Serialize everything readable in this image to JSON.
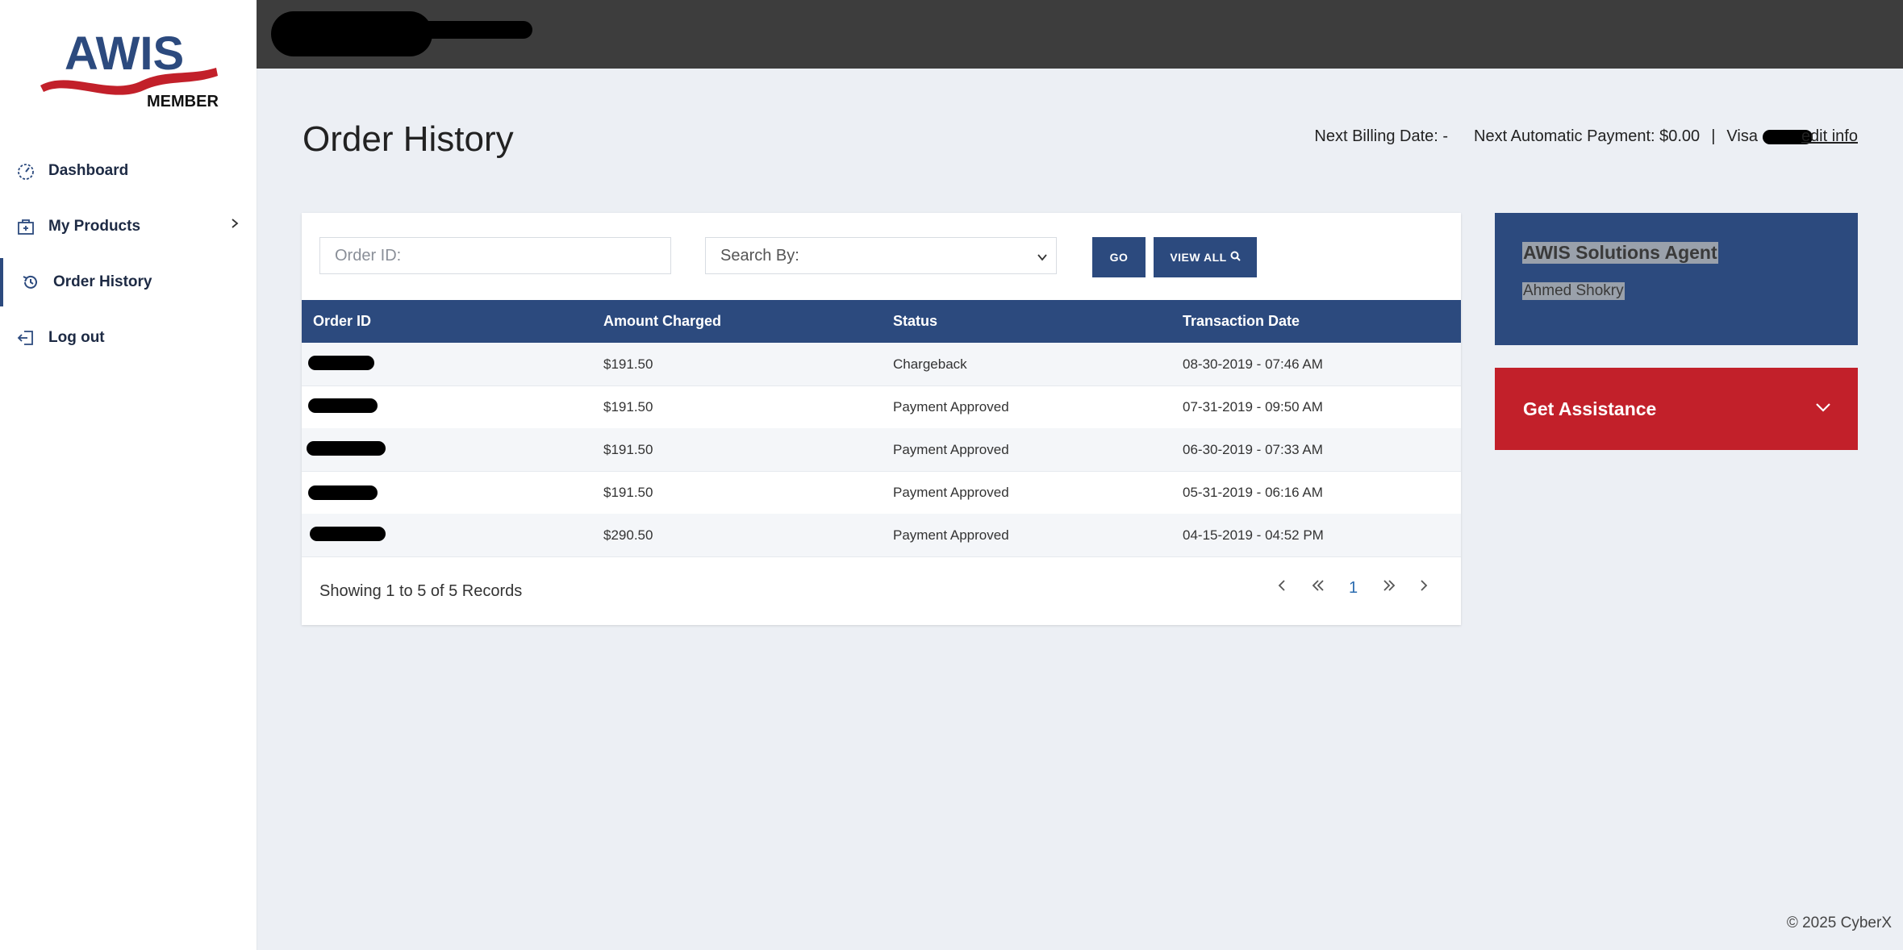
{
  "brand": {
    "logo_text": "AWIS",
    "logo_sub": "MEMBER"
  },
  "sidebar": {
    "items": [
      {
        "label": "Dashboard",
        "icon": "dashboard-gauge-icon"
      },
      {
        "label": "My Products",
        "icon": "product-box-icon"
      },
      {
        "label": "Order History",
        "icon": "history-icon"
      },
      {
        "label": "Log out",
        "icon": "logout-icon"
      }
    ]
  },
  "page": {
    "title": "Order History"
  },
  "billing": {
    "next_billing": "Next Billing Date: -",
    "next_payment": "Next Automatic Payment: $0.00",
    "separator": "|",
    "card_brand": "Visa",
    "edit_link": "edit info"
  },
  "search": {
    "order_id_placeholder": "Order ID:",
    "search_by_label": "Search By:",
    "go_label": "GO",
    "view_all_label": "VIEW ALL"
  },
  "table": {
    "headers": [
      "Order ID",
      "Amount Charged",
      "Status",
      "Transaction Date"
    ],
    "rows": [
      {
        "amount": "$191.50",
        "status": "Chargeback",
        "date": "08-30-2019 - 07:46 AM"
      },
      {
        "amount": "$191.50",
        "status": "Payment Approved",
        "date": "07-31-2019 - 09:50 AM"
      },
      {
        "amount": "$191.50",
        "status": "Payment Approved",
        "date": "06-30-2019 - 07:33 AM"
      },
      {
        "amount": "$191.50",
        "status": "Payment Approved",
        "date": "05-31-2019 - 06:16 AM"
      },
      {
        "amount": "$290.50",
        "status": "Payment Approved",
        "date": "04-15-2019 - 04:52 PM"
      }
    ],
    "records_text": "Showing 1 to 5 of 5 Records",
    "current_page": "1"
  },
  "agent": {
    "title": "AWIS Solutions Agent",
    "name": "Ahmed Shokry"
  },
  "assistance": {
    "label": "Get Assistance"
  },
  "footer": {
    "copyright": "© 2025 CyberX"
  },
  "colors": {
    "primary": "#2c4a7e",
    "danger": "#c2202a",
    "topbar": "#3d3d3d",
    "page_bg": "#eceff4"
  }
}
